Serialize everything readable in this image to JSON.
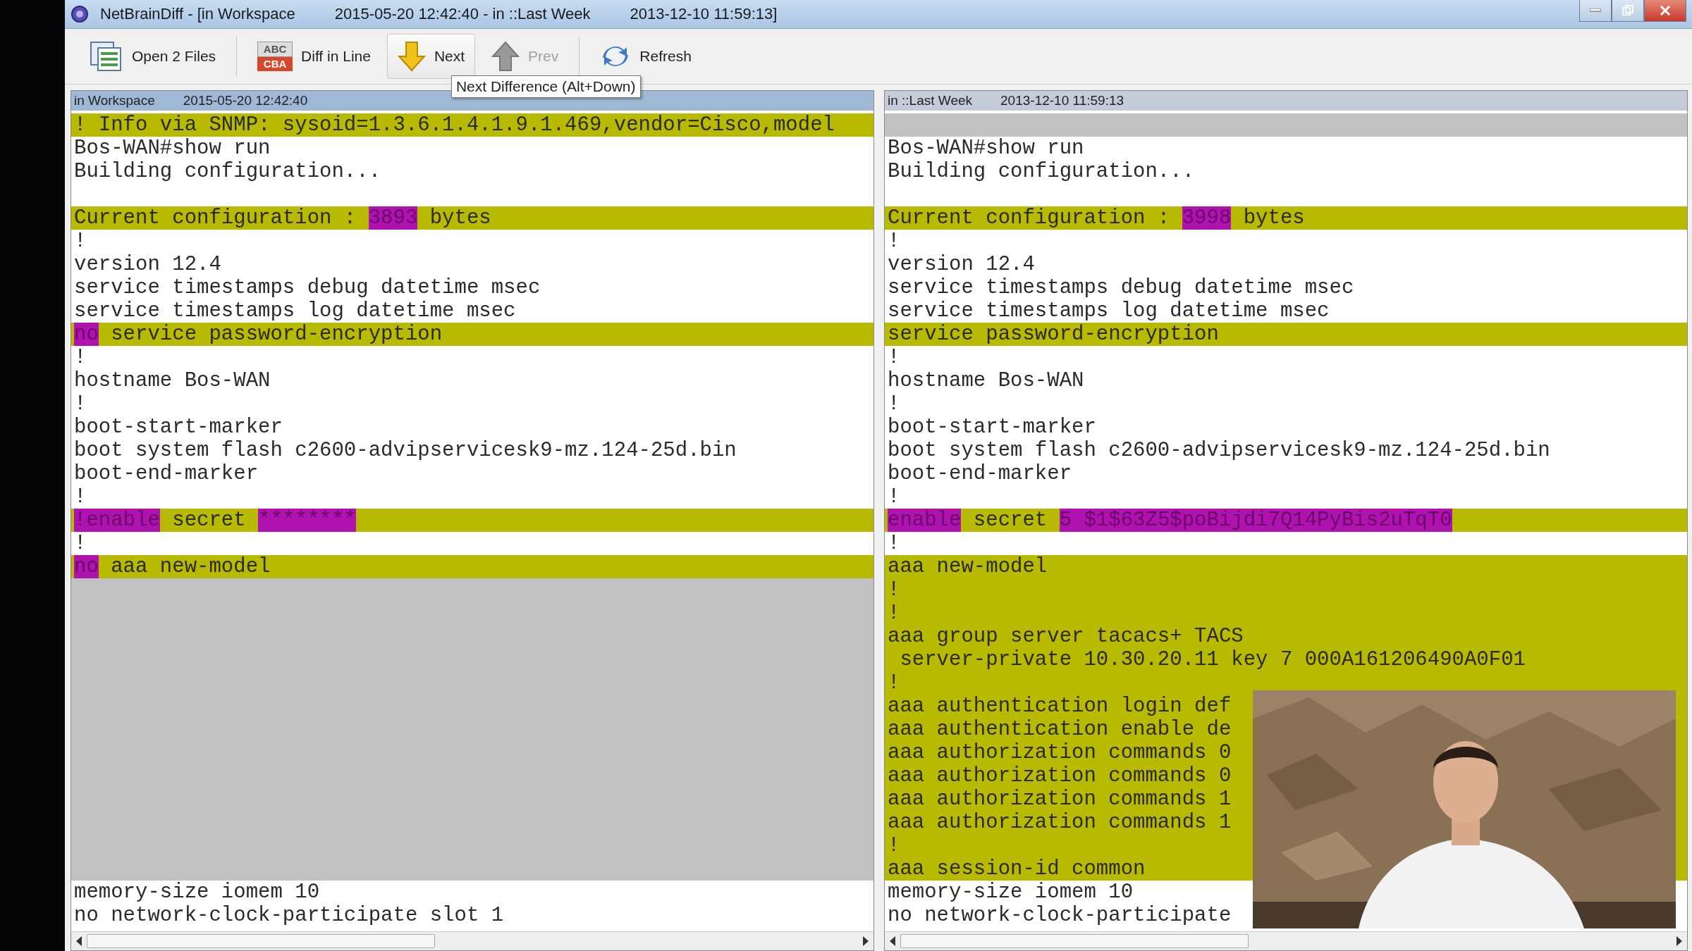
{
  "window": {
    "title_parts": [
      "NetBrainDiff - [in Workspace",
      "2015-05-20 12:42:40 - in ::Last Week",
      "2013-12-10 11:59:13]"
    ]
  },
  "toolbar": [
    {
      "kind": "open",
      "label": "Open 2 Files",
      "hovered": false,
      "disabled": false
    },
    {
      "kind": "diffline",
      "label": "Diff in Line",
      "icon_text": [
        "ABC",
        "CBA"
      ],
      "hovered": false,
      "disabled": false
    },
    {
      "kind": "next",
      "label": "Next",
      "hovered": true,
      "disabled": false
    },
    {
      "kind": "prev",
      "label": "Prev",
      "hovered": false,
      "disabled": true
    },
    {
      "kind": "refresh",
      "label": "Refresh",
      "hovered": false,
      "disabled": false
    }
  ],
  "tooltip": "Next Difference (Alt+Down)",
  "panes": [
    {
      "source": "in Workspace",
      "timestamp": "2015-05-20 12:42:40",
      "active": true,
      "lines": [
        {
          "kind": "changed",
          "parts": [
            {
              "text": "! Info via SNMP: sysoid=1.3.6.1.4.1.9.1.469,vendor=Cisco,model",
              "diff": false
            }
          ]
        },
        {
          "kind": "plain",
          "text": "Bos-WAN#show run"
        },
        {
          "kind": "plain",
          "text": "Building configuration..."
        },
        {
          "kind": "blank"
        },
        {
          "kind": "changed",
          "parts": [
            {
              "text": "Current configuration : ",
              "diff": false
            },
            {
              "text": "3893",
              "diff": true
            },
            {
              "text": " bytes",
              "diff": false
            }
          ]
        },
        {
          "kind": "plain",
          "text": "!"
        },
        {
          "kind": "plain",
          "text": "version 12.4"
        },
        {
          "kind": "plain",
          "text": "service timestamps debug datetime msec"
        },
        {
          "kind": "plain",
          "text": "service timestamps log datetime msec"
        },
        {
          "kind": "changed",
          "parts": [
            {
              "text": "no",
              "diff": true
            },
            {
              "text": " service password-encryption",
              "diff": false
            }
          ]
        },
        {
          "kind": "plain",
          "text": "!"
        },
        {
          "kind": "plain",
          "text": "hostname Bos-WAN"
        },
        {
          "kind": "plain",
          "text": "!"
        },
        {
          "kind": "plain",
          "text": "boot-start-marker"
        },
        {
          "kind": "plain",
          "text": "boot system flash c2600-advipservicesk9-mz.124-25d.bin"
        },
        {
          "kind": "plain",
          "text": "boot-end-marker"
        },
        {
          "kind": "plain",
          "text": "!"
        },
        {
          "kind": "changed",
          "parts": [
            {
              "text": "!enable",
              "diff": true
            },
            {
              "text": " secret ",
              "diff": false
            },
            {
              "text": "********",
              "diff": true
            }
          ]
        },
        {
          "kind": "plain",
          "text": "!"
        },
        {
          "kind": "changed",
          "parts": [
            {
              "text": "no",
              "diff": true
            },
            {
              "text": " aaa new-model",
              "diff": false
            }
          ]
        },
        {
          "kind": "placeholder"
        },
        {
          "kind": "placeholder"
        },
        {
          "kind": "placeholder"
        },
        {
          "kind": "placeholder"
        },
        {
          "kind": "placeholder"
        },
        {
          "kind": "placeholder"
        },
        {
          "kind": "placeholder"
        },
        {
          "kind": "placeholder"
        },
        {
          "kind": "placeholder"
        },
        {
          "kind": "placeholder"
        },
        {
          "kind": "placeholder"
        },
        {
          "kind": "placeholder"
        },
        {
          "kind": "placeholder"
        },
        {
          "kind": "plain",
          "text": "memory-size iomem 10"
        },
        {
          "kind": "plain",
          "text": "no network-clock-participate slot 1"
        }
      ]
    },
    {
      "source": "in ::Last Week",
      "timestamp": "2013-12-10 11:59:13",
      "active": false,
      "lines": [
        {
          "kind": "placeholder"
        },
        {
          "kind": "plain",
          "text": "Bos-WAN#show run"
        },
        {
          "kind": "plain",
          "text": "Building configuration..."
        },
        {
          "kind": "blank"
        },
        {
          "kind": "changed",
          "parts": [
            {
              "text": "Current configuration : ",
              "diff": false
            },
            {
              "text": "3998",
              "diff": true
            },
            {
              "text": " bytes",
              "diff": false
            }
          ]
        },
        {
          "kind": "plain",
          "text": "!"
        },
        {
          "kind": "plain",
          "text": "version 12.4"
        },
        {
          "kind": "plain",
          "text": "service timestamps debug datetime msec"
        },
        {
          "kind": "plain",
          "text": "service timestamps log datetime msec"
        },
        {
          "kind": "changed",
          "parts": [
            {
              "text": "service password-encryption",
              "diff": false
            }
          ]
        },
        {
          "kind": "plain",
          "text": "!"
        },
        {
          "kind": "plain",
          "text": "hostname Bos-WAN"
        },
        {
          "kind": "plain",
          "text": "!"
        },
        {
          "kind": "plain",
          "text": "boot-start-marker"
        },
        {
          "kind": "plain",
          "text": "boot system flash c2600-advipservicesk9-mz.124-25d.bin"
        },
        {
          "kind": "plain",
          "text": "boot-end-marker"
        },
        {
          "kind": "plain",
          "text": "!"
        },
        {
          "kind": "changed",
          "parts": [
            {
              "text": "enable",
              "diff": true
            },
            {
              "text": " secret ",
              "diff": false
            },
            {
              "text": "5 $1$63Z5$poBijdi7Q14PyBis2uTqT0",
              "diff": true
            }
          ]
        },
        {
          "kind": "plain",
          "text": "!"
        },
        {
          "kind": "changed",
          "parts": [
            {
              "text": "aaa new-model",
              "diff": false
            }
          ]
        },
        {
          "kind": "changed",
          "parts": [
            {
              "text": "!",
              "diff": false
            }
          ]
        },
        {
          "kind": "changed",
          "parts": [
            {
              "text": "!",
              "diff": false
            }
          ]
        },
        {
          "kind": "changed",
          "parts": [
            {
              "text": "aaa group server tacacs+ TACS",
              "diff": false
            }
          ]
        },
        {
          "kind": "changed",
          "parts": [
            {
              "text": " server-private 10.30.20.11 key 7 000A161206490A0F01",
              "diff": false
            }
          ]
        },
        {
          "kind": "changed",
          "parts": [
            {
              "text": "!",
              "diff": false
            }
          ]
        },
        {
          "kind": "changed",
          "parts": [
            {
              "text": "aaa authentication login def",
              "diff": false
            }
          ]
        },
        {
          "kind": "changed",
          "parts": [
            {
              "text": "aaa authentication enable de",
              "diff": false
            }
          ]
        },
        {
          "kind": "changed",
          "parts": [
            {
              "text": "aaa authorization commands 0",
              "diff": false
            }
          ]
        },
        {
          "kind": "changed",
          "parts": [
            {
              "text": "aaa authorization commands 0",
              "diff": false
            }
          ]
        },
        {
          "kind": "changed",
          "parts": [
            {
              "text": "aaa authorization commands 1",
              "diff": false
            }
          ]
        },
        {
          "kind": "changed",
          "parts": [
            {
              "text": "aaa authorization commands 1",
              "diff": false
            }
          ]
        },
        {
          "kind": "changed",
          "parts": [
            {
              "text": "!",
              "diff": false
            }
          ]
        },
        {
          "kind": "changed",
          "parts": [
            {
              "text": "aaa session-id common",
              "diff": false
            }
          ]
        },
        {
          "kind": "plain",
          "text": "memory-size iomem 10"
        },
        {
          "kind": "plain",
          "text": "no network-clock-participate"
        }
      ]
    }
  ]
}
